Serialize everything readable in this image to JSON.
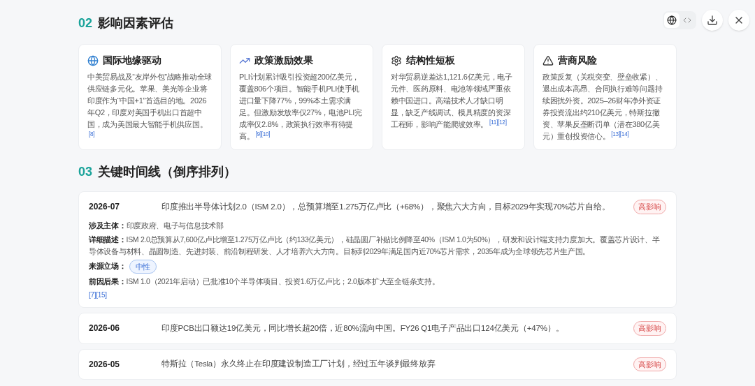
{
  "view_toggle": [
    {
      "selected": true
    },
    {
      "selected": false
    }
  ],
  "section_factors": {
    "number": "02",
    "title": "影响因素评估"
  },
  "factors": [
    {
      "title": "国际地缘驱动",
      "body": "中美贸易战及“友岸外包”战略推动全球供应链多元化。苹果、美光等企业将印度作为“中国+1”首选目的地。2026年Q2，印度对美国手机出口首超中国，成为美国最大智能手机供应国。",
      "refs": "[8]"
    },
    {
      "title": "政策激励效果",
      "body": "PLI计划累计吸引投资超200亿美元，覆盖806个项目。智能手机PLI使手机进口量下降77%，99%本土需求满足。但激励发放率仅27%，电池PLI完成率仅2.8%，政策执行效率有待提高。",
      "refs": "[9][10]"
    },
    {
      "title": "结构性短板",
      "body": "对华贸易逆差达1,121.6亿美元，电子元件、医药原料、电池等领域严重依赖中国进口。高端技术人才缺口明显，缺乏产线调试、模具精度的资深工程师，影响产能爬坡效率。",
      "refs": "[11][12]"
    },
    {
      "title": "营商风险",
      "body": "政策反复（关税突变、壁垒收紧）、退出成本高昂、合同执行难等问题持续困扰外资。2025–26财年净外资证券投资流出约210亿美元，特斯拉撤资、苹果反垄断罚单（潜在380亿美元）重创投资信心。",
      "refs": "[13][14]"
    }
  ],
  "section_timeline": {
    "number": "03",
    "title": "关键时间线（倒序排列）"
  },
  "timeline": [
    {
      "date": "2026-07",
      "title": "印度推出半导体计划2.0（ISM 2.0），总预算增至1.275万亿卢比（+68%），聚焦六大方向，目标2029年实现70%芯片自给。",
      "impact": "高影响",
      "expanded": true,
      "details": [
        {
          "kind": "text",
          "label": "涉及主体：",
          "value": "印度政府、电子与信息技术部"
        },
        {
          "kind": "text",
          "label": "详细描述：",
          "value": "ISM 2.0总预算从7,600亿卢比增至1.275万亿卢比（约133亿美元），硅晶圆厂补贴比例降至40%（ISM 1.0为50%），研发和设计端支持力度加大。覆盖芯片设计、半导体设备与材料、晶圆制造、先进封装、前沿制程研发、人才培养六大方向。目标到2029年满足国内近70%芯片需求，2035年成为全球领先芯片生产国。"
        },
        {
          "kind": "tag",
          "label": "来源立场：",
          "value": "中性"
        },
        {
          "kind": "text",
          "label": "前因后果：",
          "value": "ISM 1.0（2021年启动）已批准10个半导体项目、投资1.6万亿卢比；2.0版本扩大至全链条支持。"
        }
      ],
      "refs": "[7][15]"
    },
    {
      "date": "2026-06",
      "title": "印度PCB出口额达19亿美元，同比增长超20倍，近80%流向中国。FY26 Q1电子产品出口124亿美元（+47%）。",
      "impact": "高影响",
      "expanded": false
    },
    {
      "date": "2026-05",
      "title": "特斯拉（Tesla）永久终止在印度建设制造工厂计划，经过五年谈判最终放弃",
      "impact": "高影响",
      "expanded": false
    }
  ]
}
